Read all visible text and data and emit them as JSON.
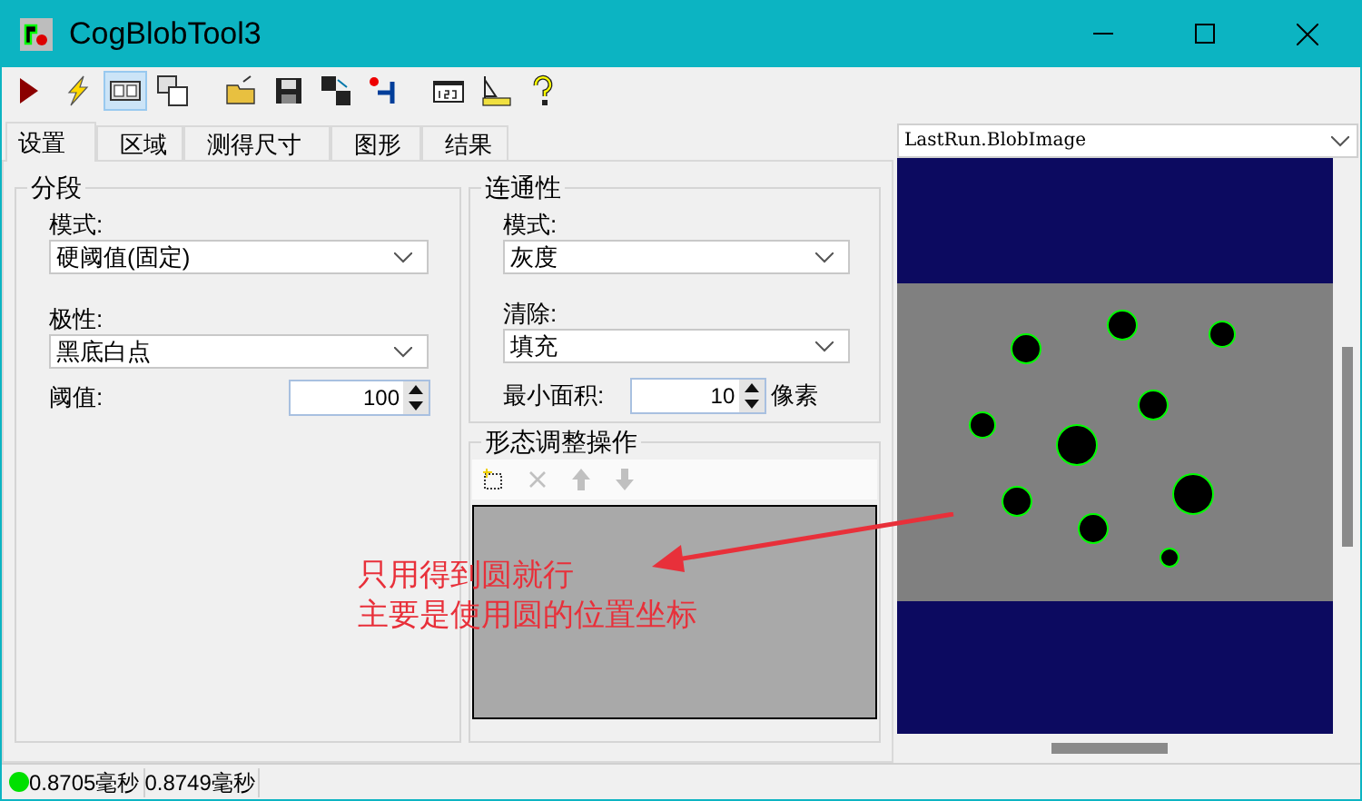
{
  "window": {
    "title": "CogBlobTool3"
  },
  "toolbar": [
    {
      "kind": "run",
      "selected": false
    },
    {
      "kind": "lightning",
      "selected": false
    },
    {
      "kind": "panel",
      "selected": true
    },
    {
      "kind": "windows",
      "selected": false
    },
    {
      "kind": "open",
      "selected": false
    },
    {
      "kind": "save",
      "selected": false
    },
    {
      "kind": "saveas",
      "selected": false
    },
    {
      "kind": "undo",
      "selected": false
    },
    {
      "kind": "numbers",
      "selected": false
    },
    {
      "kind": "ruler",
      "selected": false
    },
    {
      "kind": "help",
      "selected": false
    }
  ],
  "tabs": [
    {
      "label": "设置",
      "selected": true
    },
    {
      "label": "区域",
      "selected": false
    },
    {
      "label": "测得尺寸",
      "selected": false
    },
    {
      "label": "图形",
      "selected": false
    },
    {
      "label": "结果",
      "selected": false
    }
  ],
  "segmentation": {
    "title": "分段",
    "mode": {
      "label": "模式:",
      "value": "硬阈值(固定)"
    },
    "polarity": {
      "label": "极性:",
      "value": "黑底白点"
    },
    "threshold": {
      "label": "阈值:",
      "value": "100"
    }
  },
  "connectivity": {
    "title": "连通性",
    "mode": {
      "label": "模式:",
      "value": "灰度"
    },
    "cleanup": {
      "label": "清除:",
      "value": "填充"
    },
    "min_area": {
      "label": "最小面积:",
      "value": "10",
      "unit": "像素"
    }
  },
  "morphology": {
    "title": "形态调整操作",
    "toolbar": [
      {
        "kind": "new",
        "disabled": false
      },
      {
        "kind": "delete",
        "disabled": true
      },
      {
        "kind": "up",
        "disabled": true
      },
      {
        "kind": "down",
        "disabled": true
      }
    ]
  },
  "image_selector": {
    "value": "LastRun.BlobImage"
  },
  "annotation": {
    "lines": [
      "只用得到圆就行",
      "主要是使用圆的位置坐标"
    ]
  },
  "status_bar": {
    "ok": true,
    "times": [
      "0.8705毫秒",
      "0.8749毫秒"
    ]
  }
}
